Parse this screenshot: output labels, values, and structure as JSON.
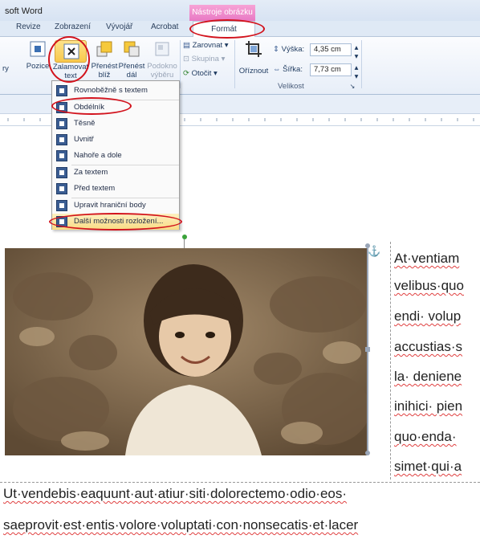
{
  "window": {
    "title": "soft Word"
  },
  "contextual_tab": {
    "header": "Nástroje obrázku"
  },
  "tabs": [
    "Revize",
    "Zobrazení",
    "Vývojář",
    "Acrobat",
    "Formát"
  ],
  "ribbon": {
    "buttons": {
      "position": "Pozice",
      "wrap_text_line1": "Zalamovat",
      "wrap_text_line2": "text",
      "bring_forward_line1": "Přenést",
      "bring_forward_line2": "blíž",
      "send_backward_line1": "Přenést",
      "send_backward_line2": "dál",
      "selection_pane_line1": "Podokno",
      "selection_pane_line2": "výběru",
      "align": "Zarovnat",
      "group": "Skupina",
      "rotate": "Otočit",
      "crop": "Oříznout",
      "left_stub": "ry"
    },
    "size": {
      "height_label": "Výška:",
      "height_value": "4,35 cm",
      "width_label": "Šířka:",
      "width_value": "7,73 cm",
      "group_label": "Velikost"
    }
  },
  "wrap_menu": {
    "items": [
      "Rovnoběžně s textem",
      "Obdélník",
      "Těsně",
      "Uvnitř",
      "Nahoře a dole",
      "Za textem",
      "Před textem",
      "Upravit hraniční body",
      "Další možnosti rozložení..."
    ]
  },
  "document": {
    "side_lines": [
      "At·ventiam",
      "velibus·quo",
      "endi· volup",
      "accustias·s",
      "la· deniene",
      "inihici· pien",
      "quo·enda· ",
      "simet·qui·a"
    ],
    "body_lines": [
      "Ut·vendebis·eaquunt·aut·atiur·siti·dolorectemo·odio·eos·",
      "saeprovit·est·entis·volore·voluptati·con·nonsecatis·et·lacer"
    ]
  },
  "colors": {
    "annotation": "#d2121c",
    "contextual": "#e879c4",
    "ribbon_bg": "#e7eef8"
  }
}
